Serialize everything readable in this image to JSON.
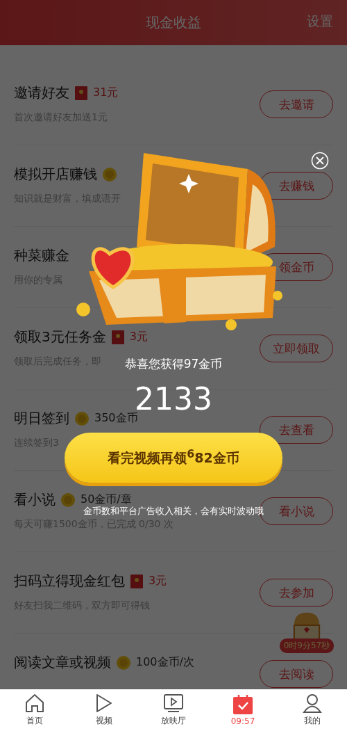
{
  "header": {
    "title": "现金收益",
    "settings": "设置"
  },
  "tasks": [
    {
      "title": "邀请好友",
      "reward": {
        "kind": "cash",
        "text": "31元"
      },
      "subtitle": "首次邀请好友加送1元",
      "action": "去邀请"
    },
    {
      "title": "模拟开店赚钱",
      "reward": {
        "kind": "coin"
      },
      "subtitle": "知识就是财富，填成语开",
      "action": "去赚钱"
    },
    {
      "title": "种菜赚金",
      "subtitle": "用你的专属",
      "action": "领金币"
    },
    {
      "title": "领取3元任务金",
      "reward": {
        "kind": "cash",
        "text": "3元"
      },
      "subtitle": "领取后完成任务，即",
      "action": "立即领取"
    },
    {
      "title": "明日签到",
      "reward": {
        "kind": "coin",
        "text": "350金币"
      },
      "subtitle": "连续签到3",
      "action": "去查看"
    },
    {
      "title": "看小说",
      "reward": {
        "kind": "coin",
        "text": "50金币/章"
      },
      "subtitle": "每天可赚1500金币，已完成 0/30 次",
      "action": "看小说"
    },
    {
      "title": "扫码立得现金红包",
      "reward": {
        "kind": "cash",
        "text": "3元"
      },
      "subtitle": "好友扫我二维码，双方即可得钱",
      "action": "去参加"
    },
    {
      "title": "阅读文章或视频",
      "reward": {
        "kind": "coin",
        "text": "100金币/次"
      },
      "action": "去阅读"
    }
  ],
  "floating_chest": {
    "countdown": "0时9分57秒"
  },
  "popup": {
    "message": "恭喜您获得97金币",
    "total": "2133",
    "button": "看完视频再领$^{6}$82金币",
    "note": "金币数和平台广告收入相关，会有实时波动哦"
  },
  "nav": [
    {
      "kind": "home",
      "label": "首页",
      "selected": false
    },
    {
      "kind": "play",
      "label": "视频",
      "selected": false
    },
    {
      "kind": "tv",
      "label": "放映厅",
      "selected": false
    },
    {
      "kind": "calendar",
      "label": "09:57",
      "selected": true
    },
    {
      "kind": "user",
      "label": "我的",
      "selected": false
    }
  ]
}
